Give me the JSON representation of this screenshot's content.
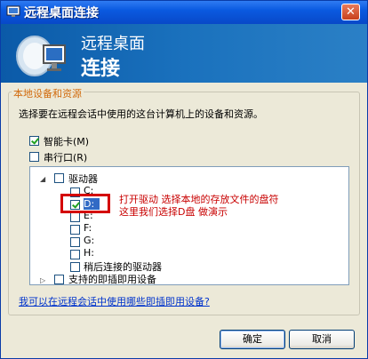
{
  "window": {
    "title": "远程桌面连接",
    "close_glyph": "✕"
  },
  "banner": {
    "line1": "远程桌面",
    "line2": "连接"
  },
  "group": {
    "legend": "本地设备和资源",
    "description": "选择要在远程会话中使用的这台计算机上的设备和资源。"
  },
  "options": {
    "smartcard": {
      "label": "智能卡(M)",
      "checked": true
    },
    "serialport": {
      "label": "串行口(R)",
      "checked": false
    }
  },
  "tree": {
    "drives": {
      "label": "驱动器",
      "expanded": true
    },
    "items": [
      {
        "label": "C:",
        "checked": false
      },
      {
        "label": "D:",
        "checked": true,
        "selected": true
      },
      {
        "label": "E:",
        "checked": false
      },
      {
        "label": "F:",
        "checked": false
      },
      {
        "label": "G:",
        "checked": false
      },
      {
        "label": "H:",
        "checked": false
      },
      {
        "label": "稍后连接的驱动器",
        "checked": false
      }
    ],
    "pnp": {
      "label": "支持的即插即用设备",
      "expanded": false
    }
  },
  "annotation": {
    "line1": "打开驱动 选择本地的存放文件的盘符",
    "line2": "这里我们选择D盘 做演示",
    "color": "#c80000"
  },
  "help_link": "我可以在远程会话中使用哪些即插即用设备?",
  "buttons": {
    "ok": "确定",
    "cancel": "取消"
  },
  "colors": {
    "titlebar": "#0a5ae0",
    "banner": "#1a71bd",
    "legend": "#d16a0c",
    "link": "#0033cc"
  }
}
